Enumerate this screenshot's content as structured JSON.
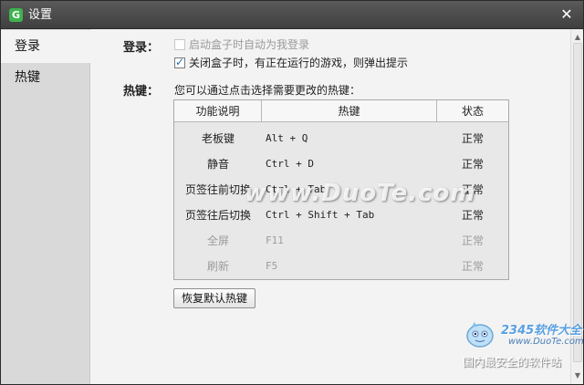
{
  "window": {
    "title": "设置",
    "app_icon_letter": "G",
    "close_glyph": "✕"
  },
  "sidebar": {
    "items": [
      {
        "label": "登录",
        "active": true
      },
      {
        "label": "热键",
        "active": false
      }
    ]
  },
  "login": {
    "label": "登录：",
    "options": [
      {
        "text": "启动盒子时自动为我登录",
        "checked": false,
        "disabled": true
      },
      {
        "text": "关闭盒子时，有正在运行的游戏，则弹出提示",
        "checked": true,
        "disabled": false
      }
    ]
  },
  "hotkeys": {
    "label": "热键：",
    "hint": "您可以通过点击选择需要更改的热键：",
    "columns": [
      "功能说明",
      "热键",
      "状态"
    ],
    "rows": [
      {
        "function": "老板键",
        "key": "Alt + Q",
        "status": "正常",
        "disabled": false
      },
      {
        "function": "静音",
        "key": "Ctrl + D",
        "status": "正常",
        "disabled": false
      },
      {
        "function": "页签往前切换",
        "key": "Ctrl + Tab",
        "status": "正常",
        "disabled": false
      },
      {
        "function": "页签往后切换",
        "key": "Ctrl + Shift + Tab",
        "status": "正常",
        "disabled": false
      },
      {
        "function": "全屏",
        "key": "F11",
        "status": "正常",
        "disabled": true
      },
      {
        "function": "刷新",
        "key": "F5",
        "status": "正常",
        "disabled": true
      }
    ],
    "restore_button": "恢复默认热键"
  },
  "watermarks": {
    "center": "www.DuoTe.com",
    "corner_logo": "2345软件大全",
    "corner_site": "www.DuoTe.com",
    "corner_slogan": "国内最安全的软件站"
  },
  "colors": {
    "accent": "#3fb34f",
    "titlebar": "#4a4a4a",
    "sidebar": "#d9d9d9"
  }
}
